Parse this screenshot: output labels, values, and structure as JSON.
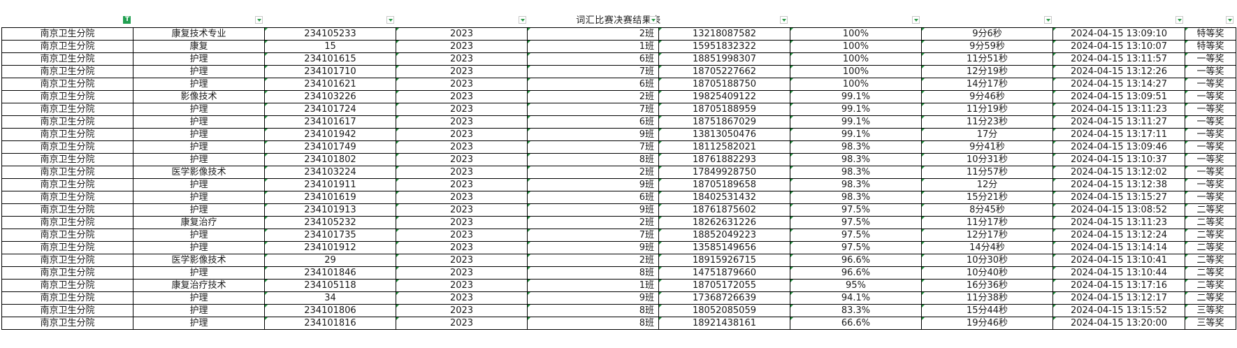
{
  "sheet": {
    "title": "词汇比赛决赛结果表",
    "filter_active_label": "T"
  },
  "rows": [
    [
      "南京卫生分院",
      "康复技术专业",
      "234105233",
      "2023",
      "2班",
      "13218087582",
      "100%",
      "9分6秒",
      "2024-04-15 13:09:10",
      "特等奖"
    ],
    [
      "南京卫生分院",
      "康复",
      "15",
      "2023",
      "1班",
      "15951832322",
      "100%",
      "9分59秒",
      "2024-04-15 13:10:07",
      "特等奖"
    ],
    [
      "南京卫生分院",
      "护理",
      "234101615",
      "2023",
      "6班",
      "18851998307",
      "100%",
      "11分51秒",
      "2024-04-15 13:11:57",
      "一等奖"
    ],
    [
      "南京卫生分院",
      "护理",
      "234101710",
      "2023",
      "7班",
      "18705227662",
      "100%",
      "12分19秒",
      "2024-04-15 13:12:26",
      "一等奖"
    ],
    [
      "南京卫生分院",
      "护理",
      "234101621",
      "2023",
      "6班",
      "18705188750",
      "100%",
      "14分17秒",
      "2024-04-15 13:14:27",
      "一等奖"
    ],
    [
      "南京卫生分院",
      "影像技术",
      "234103226",
      "2023",
      "2班",
      "19825409122",
      "99.1%",
      "9分46秒",
      "2024-04-15 13:09:51",
      "一等奖"
    ],
    [
      "南京卫生分院",
      "护理",
      "234101724",
      "2023",
      "7班",
      "18705188959",
      "99.1%",
      "11分19秒",
      "2024-04-15 13:11:23",
      "一等奖"
    ],
    [
      "南京卫生分院",
      "护理",
      "234101617",
      "2023",
      "6班",
      "18751867029",
      "99.1%",
      "11分23秒",
      "2024-04-15 13:11:27",
      "一等奖"
    ],
    [
      "南京卫生分院",
      "护理",
      "234101942",
      "2023",
      "9班",
      "13813050476",
      "99.1%",
      "17分",
      "2024-04-15 13:17:11",
      "一等奖"
    ],
    [
      "南京卫生分院",
      "护理",
      "234101749",
      "2023",
      "7班",
      "18112582021",
      "98.3%",
      "9分41秒",
      "2024-04-15 13:09:46",
      "一等奖"
    ],
    [
      "南京卫生分院",
      "护理",
      "234101802",
      "2023",
      "8班",
      "18761882293",
      "98.3%",
      "10分31秒",
      "2024-04-15 13:10:37",
      "一等奖"
    ],
    [
      "南京卫生分院",
      "医学影像技术",
      "234103224",
      "2023",
      "2班",
      "17849928750",
      "98.3%",
      "11分57秒",
      "2024-04-15 13:12:02",
      "一等奖"
    ],
    [
      "南京卫生分院",
      "护理",
      "234101911",
      "2023",
      "9班",
      "18705189658",
      "98.3%",
      "12分",
      "2024-04-15 13:12:38",
      "一等奖"
    ],
    [
      "南京卫生分院",
      "护理",
      "234101619",
      "2023",
      "6班",
      "18402531432",
      "98.3%",
      "15分21秒",
      "2024-04-15 13:15:27",
      "一等奖"
    ],
    [
      "南京卫生分院",
      "护理",
      "234101913",
      "2023",
      "9班",
      "18761875602",
      "97.5%",
      "8分45秒",
      "2024-04-15 13:08:52",
      "二等奖"
    ],
    [
      "南京卫生分院",
      "康复治疗",
      "234105232",
      "2023",
      "2班",
      "18262631226",
      "97.5%",
      "11分17秒",
      "2024-04-15 13:11:23",
      "二等奖"
    ],
    [
      "南京卫生分院",
      "护理",
      "234101735",
      "2023",
      "7班",
      "18852049223",
      "97.5%",
      "12分17秒",
      "2024-04-15 13:12:24",
      "二等奖"
    ],
    [
      "南京卫生分院",
      "护理",
      "234101912",
      "2023",
      "9班",
      "13585149656",
      "97.5%",
      "14分4秒",
      "2024-04-15 13:14:14",
      "二等奖"
    ],
    [
      "南京卫生分院",
      "医学影像技术",
      "29",
      "2023",
      "2班",
      "18915926715",
      "96.6%",
      "10分30秒",
      "2024-04-15 13:10:41",
      "二等奖"
    ],
    [
      "南京卫生分院",
      "护理",
      "234101846",
      "2023",
      "8班",
      "14751879660",
      "96.6%",
      "10分40秒",
      "2024-04-15 13:10:44",
      "二等奖"
    ],
    [
      "南京卫生分院",
      "康复治疗技术",
      "234105118",
      "2023",
      "1班",
      "18705172055",
      "95%",
      "16分36秒",
      "2024-04-15 13:17:16",
      "二等奖"
    ],
    [
      "南京卫生分院",
      "护理",
      "34",
      "2023",
      "9班",
      "17368726639",
      "94.1%",
      "11分38秒",
      "2024-04-15 13:12:17",
      "二等奖"
    ],
    [
      "南京卫生分院",
      "护理",
      "234101806",
      "2023",
      "8班",
      "18052085059",
      "83.3%",
      "15分44秒",
      "2024-04-15 13:15:52",
      "三等奖"
    ],
    [
      "南京卫生分院",
      "护理",
      "234101816",
      "2023",
      "8班",
      "18921438161",
      "66.6%",
      "19分46秒",
      "2024-04-15 13:20:00",
      "三等奖"
    ]
  ]
}
